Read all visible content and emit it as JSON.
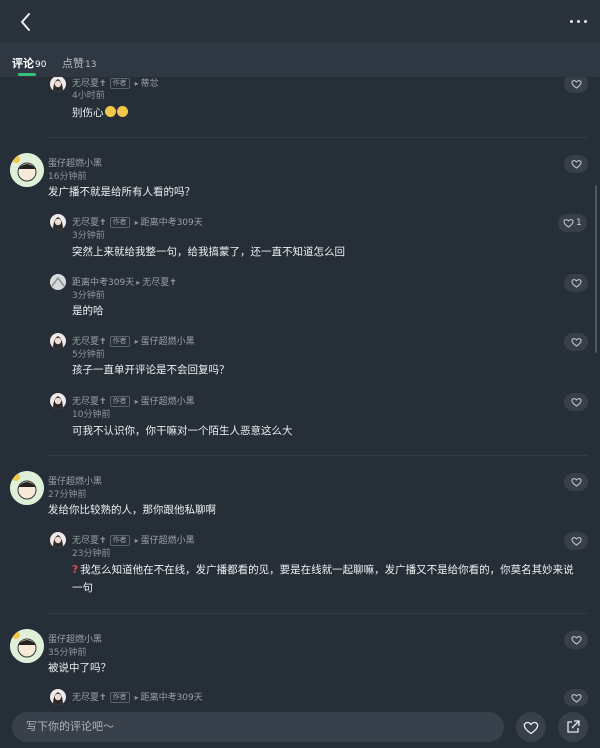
{
  "tabs": [
    {
      "label": "评论",
      "count": "90"
    },
    {
      "label": "点赞",
      "count": "13"
    }
  ],
  "comments": {
    "c0_reply": {
      "name": "无尽夏",
      "tag": "作者",
      "reply_to": "蒂忿",
      "time": "4小时前",
      "text": "别伤心"
    },
    "c1": {
      "name": "蛋仔超燃小黑",
      "time": "16分钟前",
      "text": "发广播不就是给所有人看的吗？"
    },
    "c1_r1": {
      "name": "无尽夏",
      "tag": "作者",
      "reply_to": "距离中考309天",
      "time": "3分钟前",
      "text": "突然上来就给我整一句，给我搞蒙了，还一直不知道怎么回",
      "likes": "1"
    },
    "c1_r2": {
      "name": "距离中考309天",
      "reply_to": "无尽夏",
      "time": "3分钟前",
      "text": "是的哈"
    },
    "c1_r3": {
      "name": "无尽夏",
      "tag": "作者",
      "reply_to": "蛋仔超燃小黑",
      "time": "5分钟前",
      "text": "孩子一直单开评论是不会回复吗？"
    },
    "c1_r4": {
      "name": "无尽夏",
      "tag": "作者",
      "reply_to": "蛋仔超燃小黑",
      "time": "10分钟前",
      "text": "可我不认识你，你干嘛对一个陌生人恶意这么大"
    },
    "c2": {
      "name": "蛋仔超燃小黑",
      "time": "27分钟前",
      "text": "发给你比较熟的人，那你跟他私聊啊"
    },
    "c2_r1": {
      "name": "无尽夏",
      "tag": "作者",
      "reply_to": "蛋仔超燃小黑",
      "time": "23分钟前",
      "text_line1": "我怎么知道他在不在线，发广播都看的见，要是在线就一起聊嘛，发广播又不是给你看的，你莫名其妙来说",
      "text_line2": "一句"
    },
    "c3": {
      "name": "蛋仔超燃小黑",
      "time": "35分钟前",
      "text": "被说中了吗？"
    },
    "c3_r1": {
      "name": "无尽夏",
      "tag": "作者",
      "reply_to": "距离中考309天"
    }
  },
  "bottom": {
    "placeholder": "写下你的评论吧～"
  },
  "icons": {
    "back": "chevron-left-icon",
    "more": "more-dots-icon",
    "like": "heart-icon",
    "share": "share-icon"
  },
  "colors": {
    "accent": "#35c27a",
    "background": "#262e37"
  }
}
